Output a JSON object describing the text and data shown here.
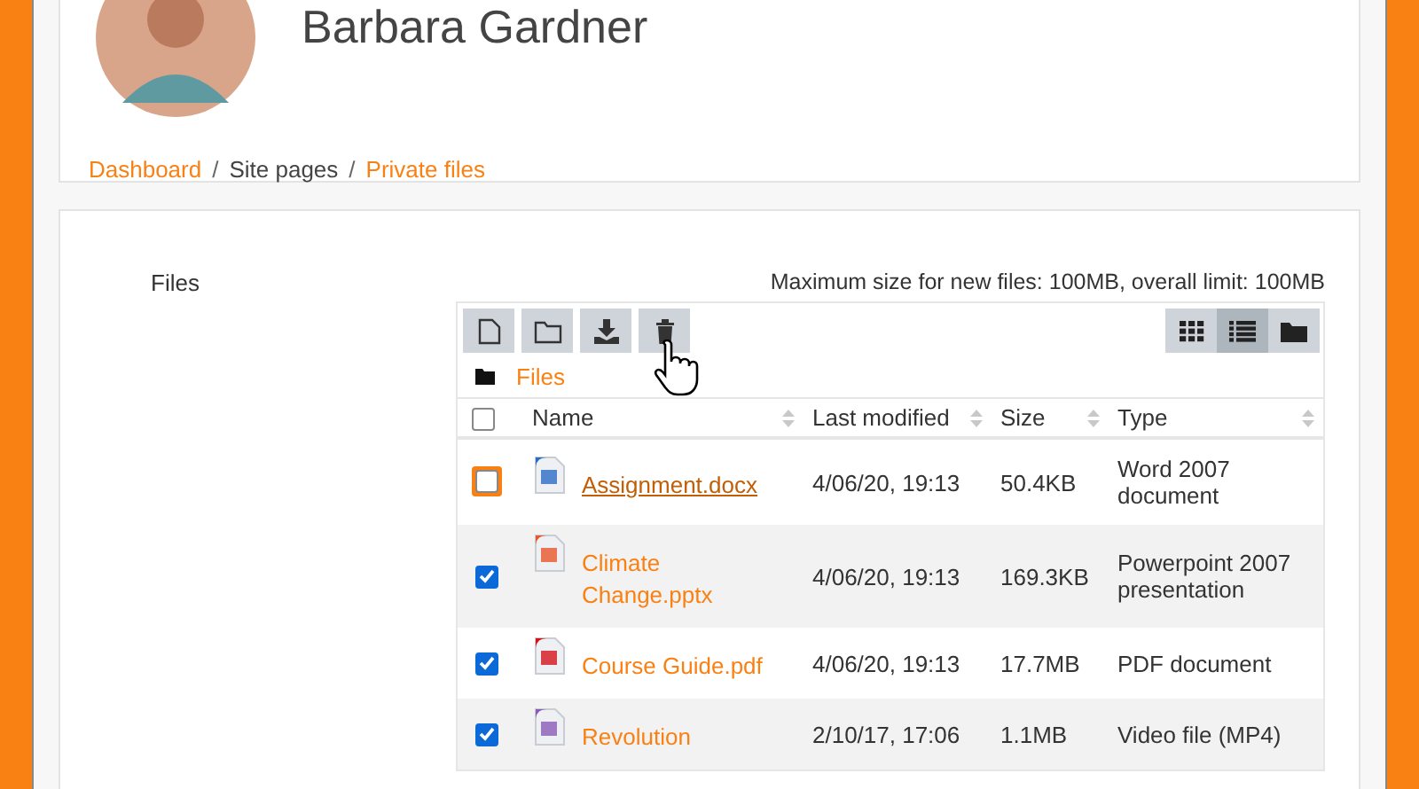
{
  "profile": {
    "name": "Barbara Gardner"
  },
  "breadcrumb_separator": "/",
  "breadcrumb": [
    {
      "label": "Dashboard",
      "link": true
    },
    {
      "label": "Site pages",
      "link": false
    },
    {
      "label": "Private files",
      "link": true
    }
  ],
  "files_label": "Files",
  "limits": "Maximum size for new files: 100MB, overall limit: 100MB",
  "views": [
    {
      "kind": "icons",
      "selected": false
    },
    {
      "kind": "list",
      "selected": true
    },
    {
      "kind": "tree",
      "selected": false
    }
  ],
  "path": "Files",
  "table": {
    "columns": [
      "Name",
      "Last modified",
      "Size",
      "Type"
    ],
    "select_all": {
      "checked": false
    },
    "rows": [
      {
        "kind": "word",
        "name": "Assignment.docx",
        "modified": "4/06/20, 19:13",
        "size": "50.4KB",
        "type": "Word 2007 document",
        "checked": false,
        "focused": true
      },
      {
        "kind": "powerpoint",
        "name": "Climate Change.pptx",
        "modified": "4/06/20, 19:13",
        "size": "169.3KB",
        "type": "Powerpoint 2007 presentation",
        "checked": true,
        "focused": false
      },
      {
        "kind": "pdf",
        "name": "Course Guide.pdf",
        "modified": "4/06/20, 19:13",
        "size": "17.7MB",
        "type": "PDF document",
        "checked": true,
        "focused": false
      },
      {
        "kind": "video",
        "name": "Revolution",
        "modified": "2/10/17, 17:06",
        "size": "1.1MB",
        "type": "Video file (MP4)",
        "checked": true,
        "focused": false
      }
    ]
  }
}
